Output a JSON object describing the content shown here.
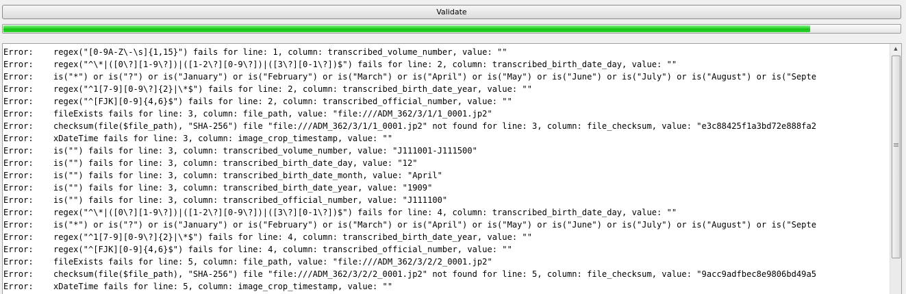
{
  "toolbar": {
    "validate_label": "Validate"
  },
  "progress": {
    "value_fraction": 0.9
  },
  "log": {
    "lines": [
      {
        "level": "Error:",
        "message": "regex(\"[0-9A-Z\\-\\s]{1,15}\") fails for line: 1, column: transcribed_volume_number, value: \"\""
      },
      {
        "level": "Error:",
        "message": "regex(\"^\\*|([0\\?][1-9\\?])|([1-2\\?][0-9\\?])|([3\\?][0-1\\?])$\") fails for line: 2, column: transcribed_birth_date_day, value: \"\""
      },
      {
        "level": "Error:",
        "message": "is(\"*\") or is(\"?\") or is(\"January\") or is(\"February\") or is(\"March\") or is(\"April\") or is(\"May\") or is(\"June\") or is(\"July\") or is(\"August\") or is(\"Septe"
      },
      {
        "level": "Error:",
        "message": "regex(\"^1[7-9][0-9\\?]{2}|\\*$\") fails for line: 2, column: transcribed_birth_date_year, value: \"\""
      },
      {
        "level": "Error:",
        "message": "regex(\"^[FJK][0-9]{4,6}$\") fails for line: 2, column: transcribed_official_number, value: \"\""
      },
      {
        "level": "Error:",
        "message": "fileExists fails for line: 3, column: file_path, value: \"file:///ADM_362/3/1/1_0001.jp2\""
      },
      {
        "level": "Error:",
        "message": "checksum(file($file_path), \"SHA-256\") file \"file:///ADM_362/3/1/1_0001.jp2\" not found for line: 3, column: file_checksum, value: \"e3c88425f1a3bd72e888fa2"
      },
      {
        "level": "Error:",
        "message": "xDateTime fails for line: 3, column: image_crop_timestamp, value: \"\""
      },
      {
        "level": "Error:",
        "message": "is(\"\") fails for line: 3, column: transcribed_volume_number, value: \"J111001-J111500\""
      },
      {
        "level": "Error:",
        "message": "is(\"\") fails for line: 3, column: transcribed_birth_date_day, value: \"12\""
      },
      {
        "level": "Error:",
        "message": "is(\"\") fails for line: 3, column: transcribed_birth_date_month, value: \"April\""
      },
      {
        "level": "Error:",
        "message": "is(\"\") fails for line: 3, column: transcribed_birth_date_year, value: \"1909\""
      },
      {
        "level": "Error:",
        "message": "is(\"\") fails for line: 3, column: transcribed_official_number, value: \"J111100\""
      },
      {
        "level": "Error:",
        "message": "regex(\"^\\*|([0\\?][1-9\\?])|([1-2\\?][0-9\\?])|([3\\?][0-1\\?])$\") fails for line: 4, column: transcribed_birth_date_day, value: \"\""
      },
      {
        "level": "Error:",
        "message": "is(\"*\") or is(\"?\") or is(\"January\") or is(\"February\") or is(\"March\") or is(\"April\") or is(\"May\") or is(\"June\") or is(\"July\") or is(\"August\") or is(\"Septe"
      },
      {
        "level": "Error:",
        "message": "regex(\"^1[7-9][0-9\\?]{2}|\\*$\") fails for line: 4, column: transcribed_birth_date_year, value: \"\""
      },
      {
        "level": "Error:",
        "message": "regex(\"^[FJK][0-9]{4,6}$\") fails for line: 4, column: transcribed_official_number, value: \"\""
      },
      {
        "level": "Error:",
        "message": "fileExists fails for line: 5, column: file_path, value: \"file:///ADM_362/3/2/2_0001.jp2\""
      },
      {
        "level": "Error:",
        "message": "checksum(file($file_path), \"SHA-256\") file \"file:///ADM_362/3/2/2_0001.jp2\" not found for line: 5, column: file_checksum, value: \"9acc9adfbec8e9806bd49a5"
      },
      {
        "level": "Error:",
        "message": "xDateTime fails for line: 5, column: image_crop_timestamp, value: \"\""
      }
    ]
  },
  "icons": {
    "scroll_up": "up-arrow-icon",
    "thumb_grip": "grip-icon"
  },
  "colors": {
    "progress": "#16c216",
    "background": "#f0f0f0",
    "log_background": "#ffffff"
  }
}
